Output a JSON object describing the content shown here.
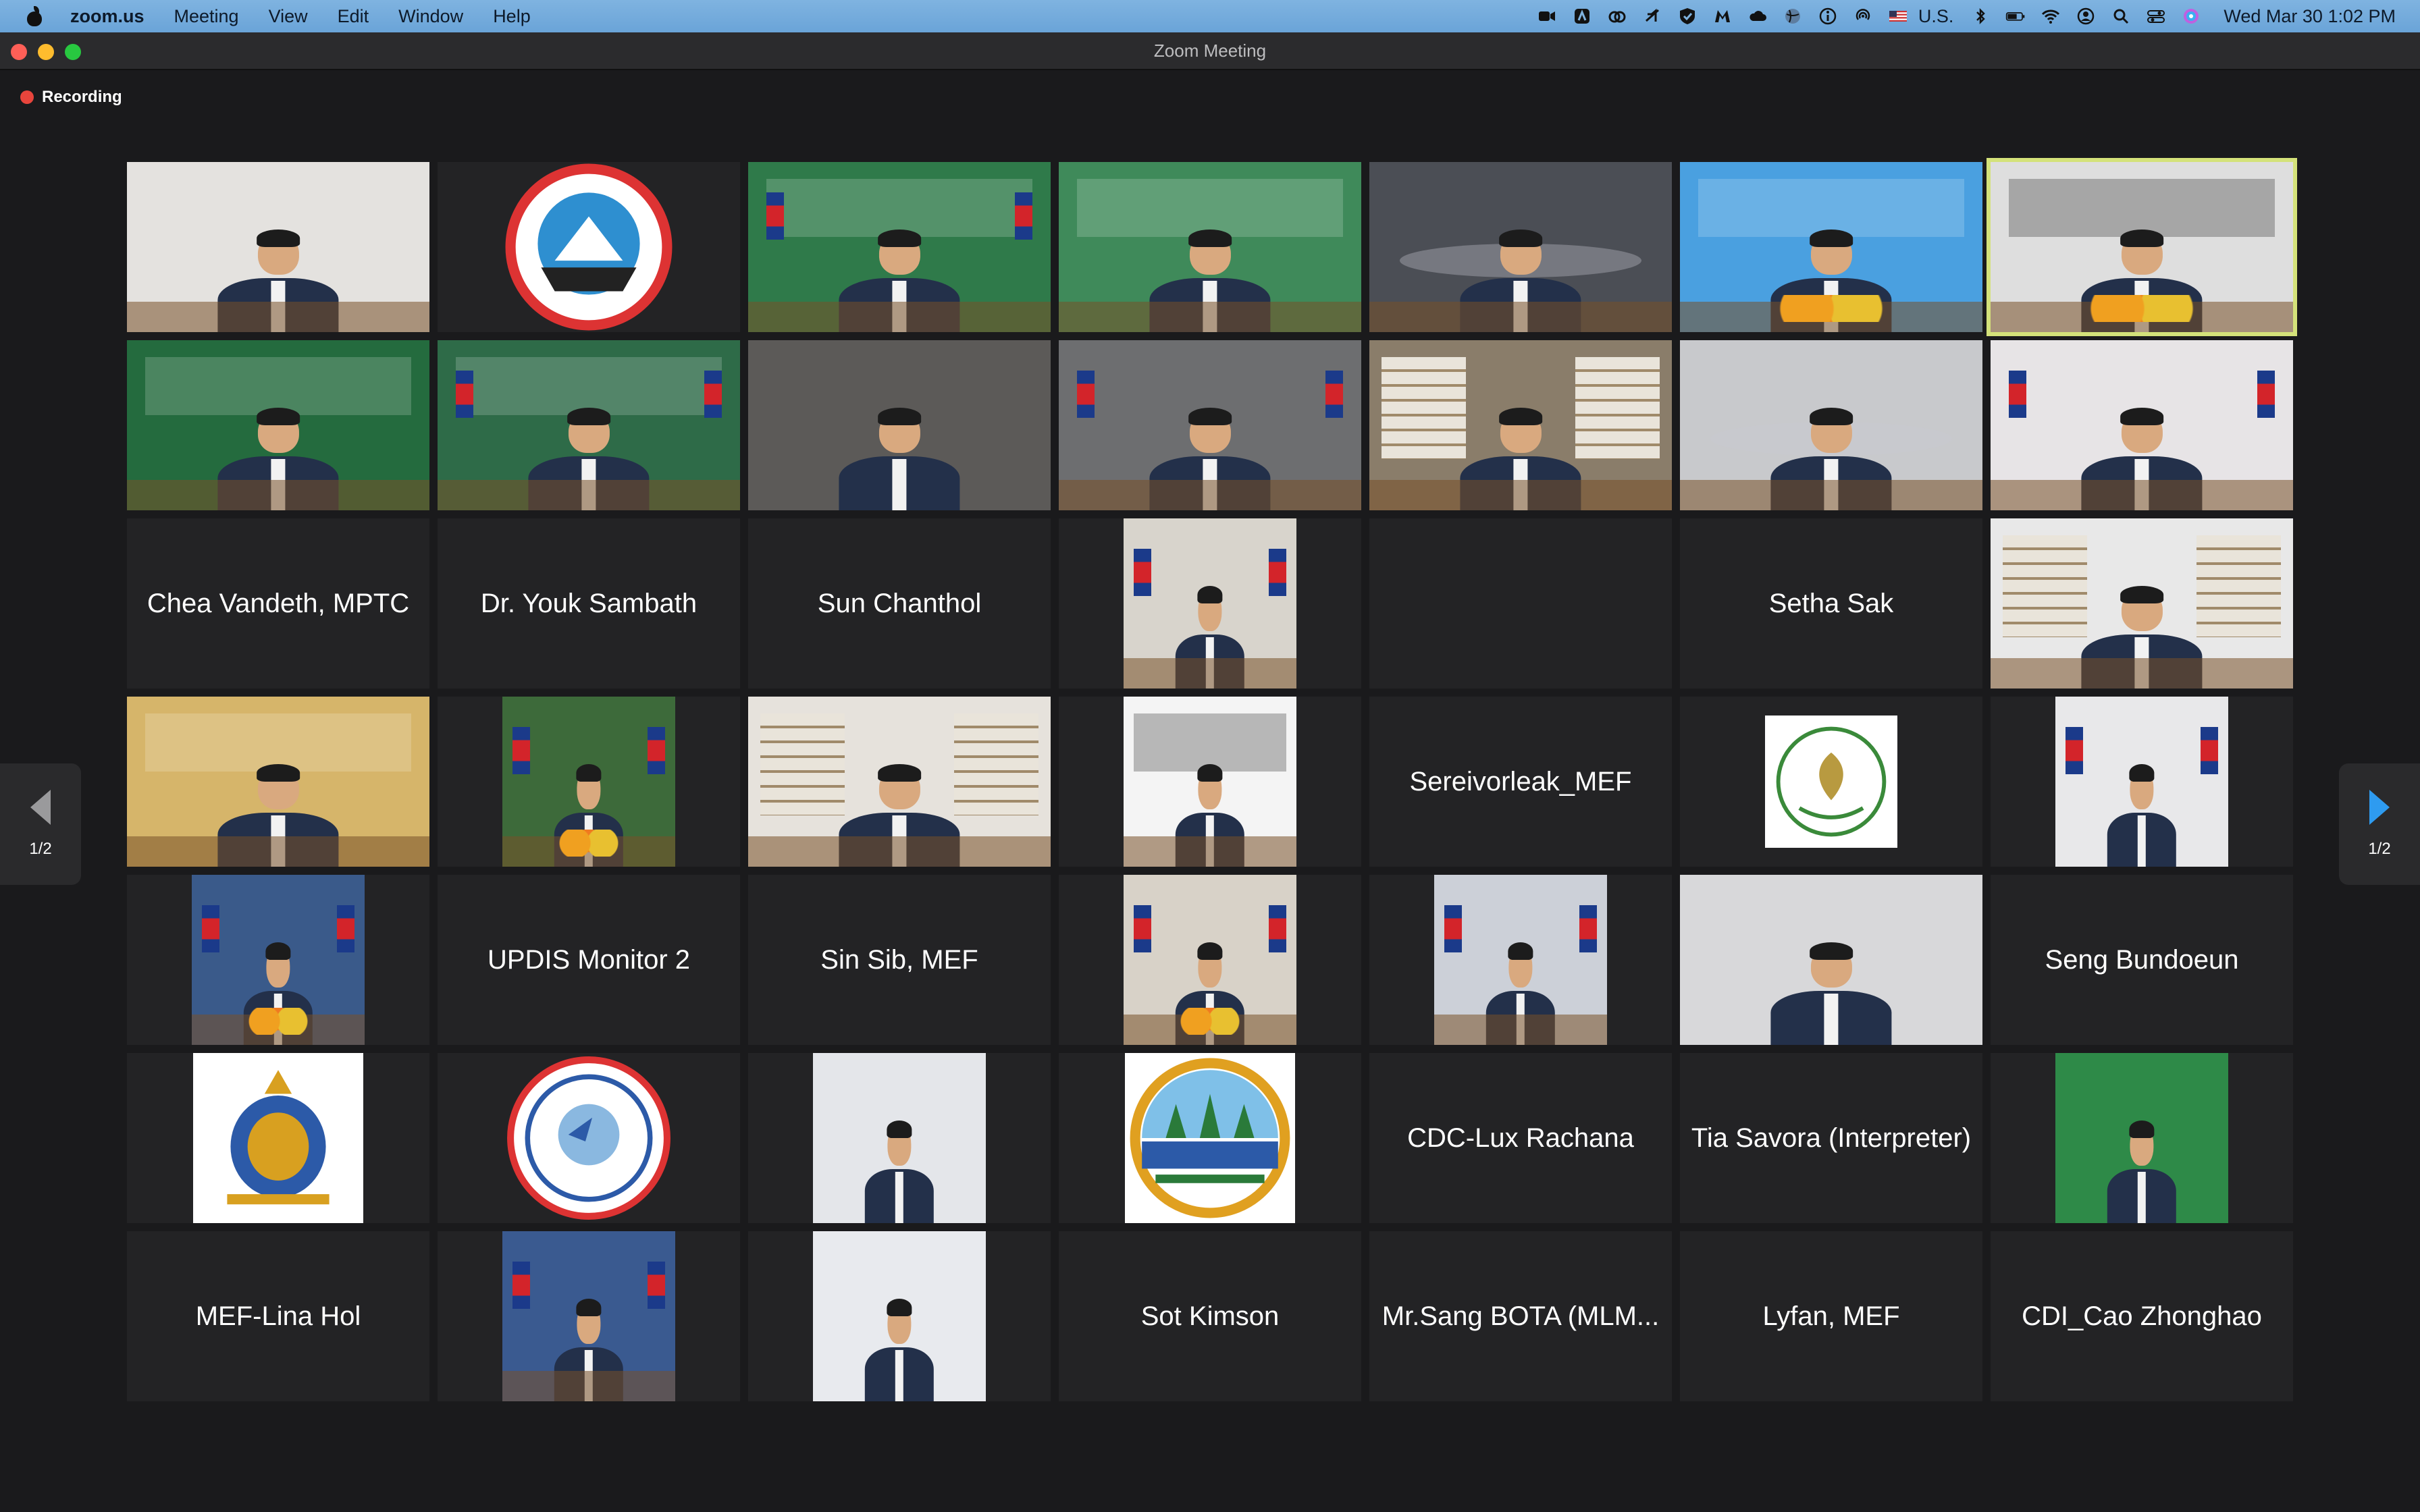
{
  "menubar": {
    "app_name": "zoom.us",
    "items": [
      "Meeting",
      "View",
      "Edit",
      "Window",
      "Help"
    ],
    "input_source": "U.S.",
    "clock": "Wed Mar 30  1:02 PM"
  },
  "window": {
    "title": "Zoom Meeting",
    "recording_label": "Recording"
  },
  "pagination": {
    "prev_label": "1/2",
    "next_label": "1/2"
  },
  "tiles": [
    {
      "name": "",
      "kind": "video",
      "bg": "#e4e2df",
      "variant": "office-hand"
    },
    {
      "name": "",
      "kind": "logo",
      "logo": "ministry-commerce-logo"
    },
    {
      "name": "",
      "kind": "video",
      "bg": "#2f7a4a",
      "variant": "banner-flags"
    },
    {
      "name": "",
      "kind": "video",
      "bg": "#3f8a5a",
      "variant": "banner-green"
    },
    {
      "name": "",
      "kind": "video",
      "bg": "#4b4e55",
      "variant": "conference-room"
    },
    {
      "name": "",
      "kind": "video",
      "bg": "#4aa0e0",
      "variant": "banner-blue"
    },
    {
      "name": "",
      "kind": "video",
      "bg": "#dedede",
      "variant": "banner-flowers",
      "active": true
    },
    {
      "name": "",
      "kind": "video",
      "bg": "#246b3e",
      "variant": "ministry-tourism"
    },
    {
      "name": "",
      "kind": "video",
      "bg": "#2e6b48",
      "variant": "banner-flags"
    },
    {
      "name": "",
      "kind": "video",
      "bg": "#5c5a58",
      "variant": "closeup"
    },
    {
      "name": "",
      "kind": "video",
      "bg": "#6d6e70",
      "variant": "flags-desk"
    },
    {
      "name": "",
      "kind": "video",
      "bg": "#8a7d6a",
      "variant": "bookshelf"
    },
    {
      "name": "",
      "kind": "video",
      "bg": "#c8c9cc",
      "variant": "conference-room"
    },
    {
      "name": "",
      "kind": "video",
      "bg": "#e7e4e6",
      "variant": "flags-curtains"
    },
    {
      "name": "Chea Vandeth, MPTC",
      "kind": "name"
    },
    {
      "name": "Dr. Youk Sambath",
      "kind": "name"
    },
    {
      "name": "Sun Chanthol",
      "kind": "name"
    },
    {
      "name": "",
      "kind": "video",
      "bg": "#d8d4cc",
      "variant": "flags-desk",
      "narrow": true
    },
    {
      "name": "",
      "kind": "empty"
    },
    {
      "name": "Setha Sak",
      "kind": "name"
    },
    {
      "name": "",
      "kind": "video",
      "bg": "#e8e8e8",
      "variant": "bookshelf"
    },
    {
      "name": "",
      "kind": "video",
      "bg": "#d6b56a",
      "variant": "banner-gold"
    },
    {
      "name": "",
      "kind": "video",
      "bg": "#3d6a3a",
      "variant": "chair-flowers",
      "narrow": true
    },
    {
      "name": "",
      "kind": "video",
      "bg": "#e6e2dc",
      "variant": "bookshelf"
    },
    {
      "name": "",
      "kind": "video",
      "bg": "#f4f4f4",
      "variant": "banner-green-woman",
      "narrow": true
    },
    {
      "name": "Sereivorleak_MEF",
      "kind": "name"
    },
    {
      "name": "",
      "kind": "logo",
      "logo": "ministry-economy-finance-logo",
      "small": true
    },
    {
      "name": "",
      "kind": "video",
      "bg": "#e8e8ea",
      "variant": "uniform",
      "narrow": true
    },
    {
      "name": "",
      "kind": "video",
      "bg": "#3a5a8a",
      "variant": "chair-flowers",
      "narrow": true
    },
    {
      "name": "UPDIS Monitor 2",
      "kind": "name"
    },
    {
      "name": "Sin Sib, MEF",
      "kind": "name"
    },
    {
      "name": "",
      "kind": "video",
      "bg": "#d8d2c8",
      "variant": "chair-flowers",
      "narrow": true
    },
    {
      "name": "",
      "kind": "video",
      "bg": "#ccd0d8",
      "variant": "flags-desk",
      "narrow": true
    },
    {
      "name": "",
      "kind": "video",
      "bg": "#d8d8da",
      "variant": "portrait",
      "small": true
    },
    {
      "name": "Seng Bundoeun",
      "kind": "name"
    },
    {
      "name": "",
      "kind": "logo",
      "logo": "royal-crest-logo",
      "narrow": true
    },
    {
      "name": "",
      "kind": "logo",
      "logo": "ministers-office-logo"
    },
    {
      "name": "",
      "kind": "video",
      "bg": "#e4e6ea",
      "variant": "portrait",
      "narrow": true
    },
    {
      "name": "",
      "kind": "logo",
      "logo": "angkor-emblem-logo",
      "narrow": true
    },
    {
      "name": "CDC-Lux Rachana",
      "kind": "name"
    },
    {
      "name": "Tia Savora (Interpreter)",
      "kind": "name"
    },
    {
      "name": "",
      "kind": "video",
      "bg": "#2e8a48",
      "variant": "portrait",
      "narrow": true
    },
    {
      "name": "MEF-Lina Hol",
      "kind": "name"
    },
    {
      "name": "",
      "kind": "video",
      "bg": "#3a5a90",
      "variant": "flags-desk",
      "narrow": true
    },
    {
      "name": "",
      "kind": "video",
      "bg": "#e8eaee",
      "variant": "portrait",
      "narrow": true
    },
    {
      "name": "Sot Kimson",
      "kind": "name"
    },
    {
      "name": "Mr.Sang BOTA (MLM...",
      "kind": "name"
    },
    {
      "name": "Lyfan, MEF",
      "kind": "name"
    },
    {
      "name": "CDI_Cao Zhonghao",
      "kind": "name"
    }
  ]
}
